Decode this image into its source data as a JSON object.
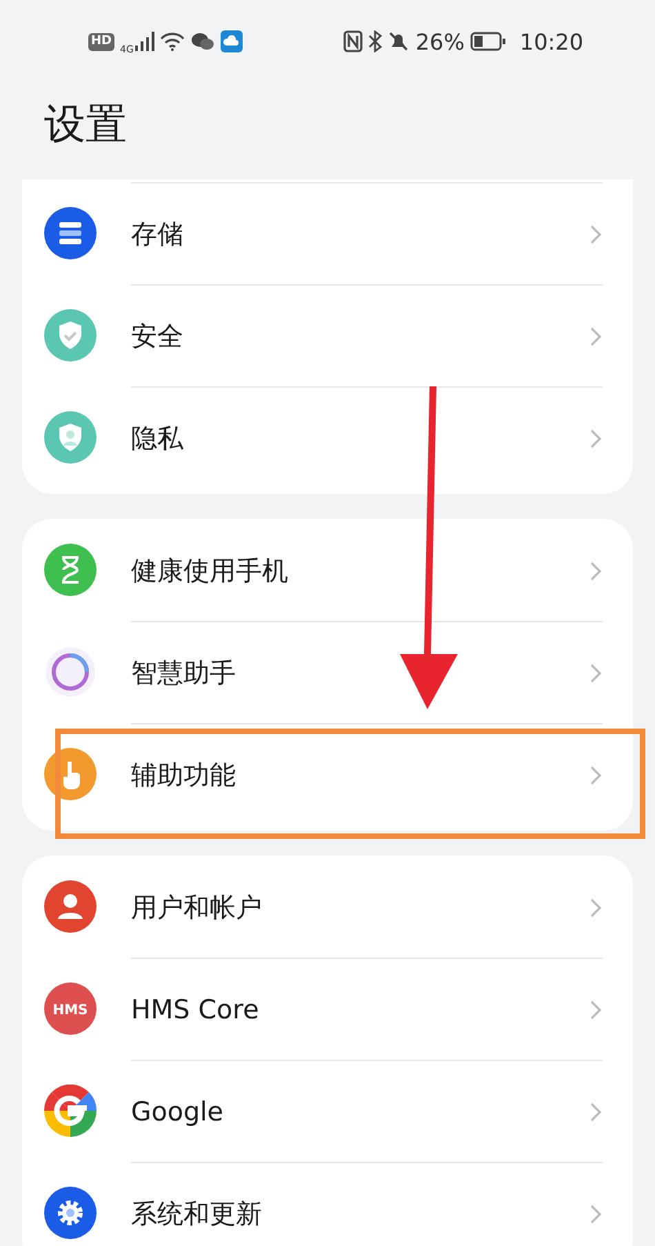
{
  "status_bar": {
    "hd": "HD",
    "network": "4G",
    "battery_percent": "26%",
    "time": "10:20"
  },
  "title": "设置",
  "groups": [
    {
      "items": [
        {
          "kind": "storage",
          "label": "存储",
          "highlighted": false
        },
        {
          "kind": "security",
          "label": "安全",
          "highlighted": false
        },
        {
          "kind": "privacy",
          "label": "隐私",
          "highlighted": false
        }
      ]
    },
    {
      "items": [
        {
          "kind": "health",
          "label": "健康使用手机",
          "highlighted": false
        },
        {
          "kind": "assistant",
          "label": "智慧助手",
          "highlighted": false
        },
        {
          "kind": "accessibility",
          "label": "辅助功能",
          "highlighted": true
        }
      ]
    },
    {
      "items": [
        {
          "kind": "user",
          "label": "用户和帐户",
          "highlighted": false
        },
        {
          "kind": "hms",
          "icon_text": "HMS",
          "label": "HMS Core",
          "highlighted": false
        },
        {
          "kind": "google",
          "label": "Google",
          "highlighted": false
        },
        {
          "kind": "system",
          "label": "系统和更新",
          "highlighted": false
        }
      ]
    }
  ]
}
